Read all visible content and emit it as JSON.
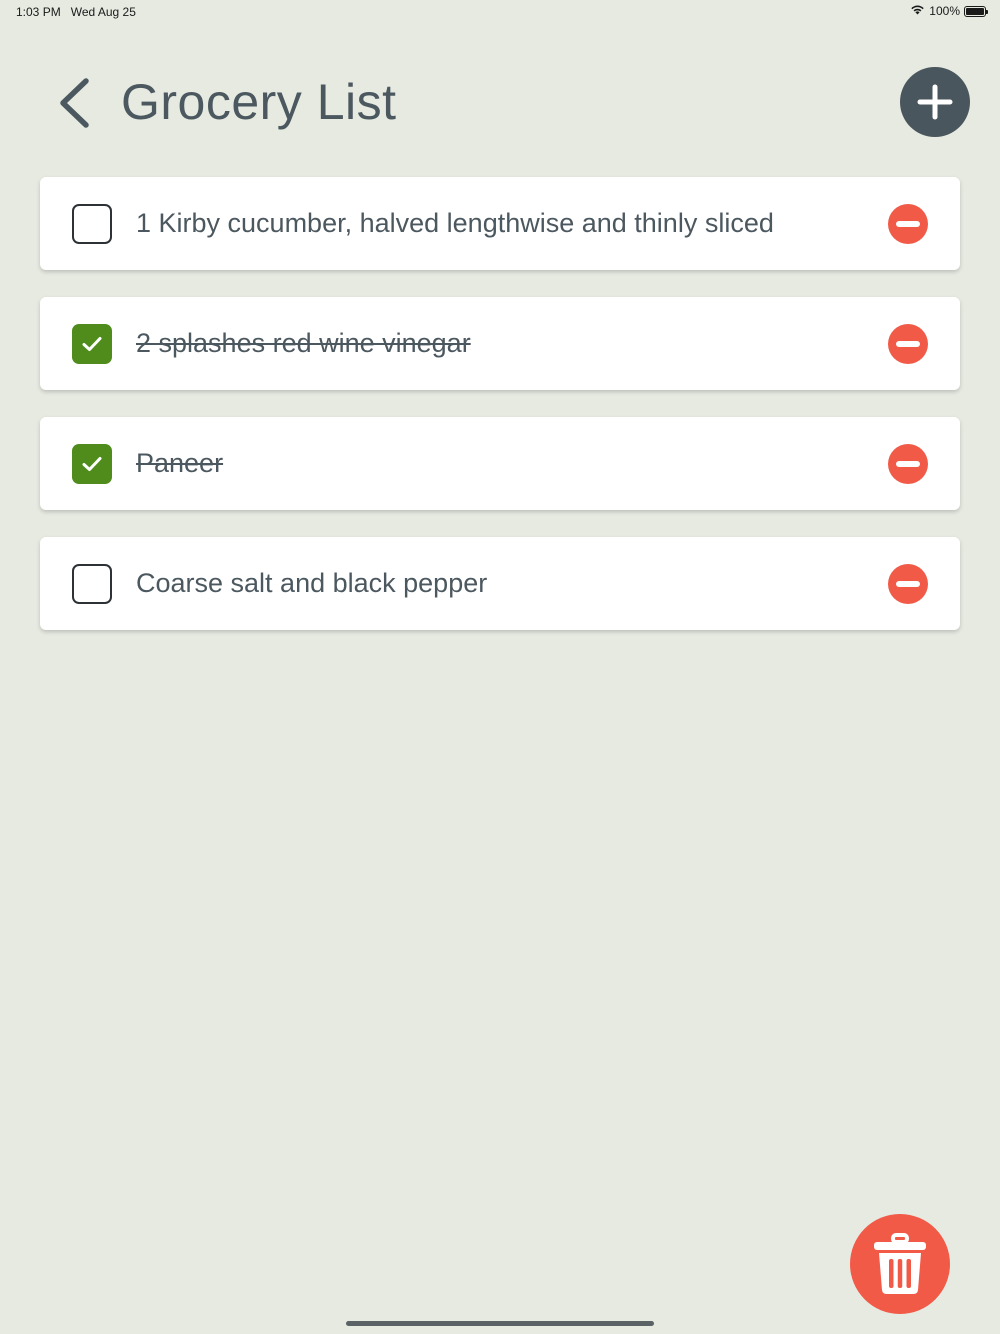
{
  "status_bar": {
    "time": "1:03 PM",
    "date": "Wed Aug 25",
    "battery_text": "100%"
  },
  "header": {
    "title": "Grocery List",
    "back_icon": "chevron-left-icon",
    "add_icon": "plus-icon"
  },
  "items": [
    {
      "label": "1 Kirby cucumber, halved lengthwise and thinly sliced",
      "checked": false
    },
    {
      "label": "2 splashes red wine vinegar",
      "checked": true
    },
    {
      "label": "Paneer",
      "checked": true
    },
    {
      "label": "Coarse salt and black pepper",
      "checked": false
    }
  ],
  "actions": {
    "trash_icon": "trash-icon"
  },
  "colors": {
    "background": "#e6eae1",
    "text": "#4c585f",
    "accent_remove": "#f25a48",
    "checked_green": "#4f8c1b",
    "add_button": "#4a565d"
  }
}
